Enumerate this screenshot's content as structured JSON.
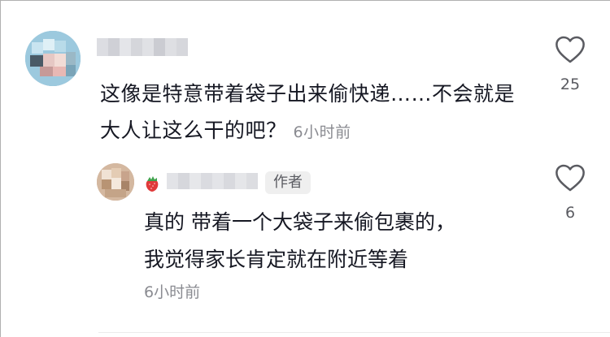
{
  "comment": {
    "text": "这像是特意带着袋子出来偷快递……不会就是大人让这么干的吧？",
    "time": "6小时前",
    "like_count": "25"
  },
  "reply": {
    "author_badge": "作者",
    "text_line1": "真的 带着一个大袋子来偷包裹的，",
    "text_line2": "我觉得家长肯定就在附近等着",
    "time": "6小时前",
    "like_count": "6"
  },
  "icons": {
    "like": "heart-outline-icon",
    "badge": "strawberry-icon"
  }
}
